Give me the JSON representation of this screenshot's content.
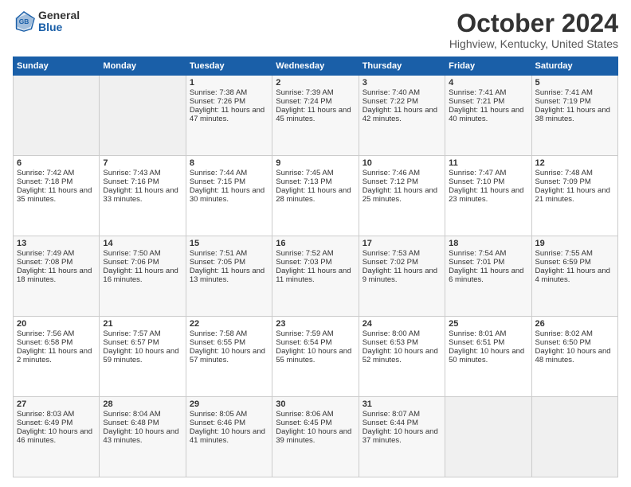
{
  "logo": {
    "general": "General",
    "blue": "Blue"
  },
  "header": {
    "month": "October 2024",
    "location": "Highview, Kentucky, United States"
  },
  "weekdays": [
    "Sunday",
    "Monday",
    "Tuesday",
    "Wednesday",
    "Thursday",
    "Friday",
    "Saturday"
  ],
  "weeks": [
    [
      {
        "day": "",
        "content": ""
      },
      {
        "day": "",
        "content": ""
      },
      {
        "day": "1",
        "content": "Sunrise: 7:38 AM\nSunset: 7:26 PM\nDaylight: 11 hours and 47 minutes."
      },
      {
        "day": "2",
        "content": "Sunrise: 7:39 AM\nSunset: 7:24 PM\nDaylight: 11 hours and 45 minutes."
      },
      {
        "day": "3",
        "content": "Sunrise: 7:40 AM\nSunset: 7:22 PM\nDaylight: 11 hours and 42 minutes."
      },
      {
        "day": "4",
        "content": "Sunrise: 7:41 AM\nSunset: 7:21 PM\nDaylight: 11 hours and 40 minutes."
      },
      {
        "day": "5",
        "content": "Sunrise: 7:41 AM\nSunset: 7:19 PM\nDaylight: 11 hours and 38 minutes."
      }
    ],
    [
      {
        "day": "6",
        "content": "Sunrise: 7:42 AM\nSunset: 7:18 PM\nDaylight: 11 hours and 35 minutes."
      },
      {
        "day": "7",
        "content": "Sunrise: 7:43 AM\nSunset: 7:16 PM\nDaylight: 11 hours and 33 minutes."
      },
      {
        "day": "8",
        "content": "Sunrise: 7:44 AM\nSunset: 7:15 PM\nDaylight: 11 hours and 30 minutes."
      },
      {
        "day": "9",
        "content": "Sunrise: 7:45 AM\nSunset: 7:13 PM\nDaylight: 11 hours and 28 minutes."
      },
      {
        "day": "10",
        "content": "Sunrise: 7:46 AM\nSunset: 7:12 PM\nDaylight: 11 hours and 25 minutes."
      },
      {
        "day": "11",
        "content": "Sunrise: 7:47 AM\nSunset: 7:10 PM\nDaylight: 11 hours and 23 minutes."
      },
      {
        "day": "12",
        "content": "Sunrise: 7:48 AM\nSunset: 7:09 PM\nDaylight: 11 hours and 21 minutes."
      }
    ],
    [
      {
        "day": "13",
        "content": "Sunrise: 7:49 AM\nSunset: 7:08 PM\nDaylight: 11 hours and 18 minutes."
      },
      {
        "day": "14",
        "content": "Sunrise: 7:50 AM\nSunset: 7:06 PM\nDaylight: 11 hours and 16 minutes."
      },
      {
        "day": "15",
        "content": "Sunrise: 7:51 AM\nSunset: 7:05 PM\nDaylight: 11 hours and 13 minutes."
      },
      {
        "day": "16",
        "content": "Sunrise: 7:52 AM\nSunset: 7:03 PM\nDaylight: 11 hours and 11 minutes."
      },
      {
        "day": "17",
        "content": "Sunrise: 7:53 AM\nSunset: 7:02 PM\nDaylight: 11 hours and 9 minutes."
      },
      {
        "day": "18",
        "content": "Sunrise: 7:54 AM\nSunset: 7:01 PM\nDaylight: 11 hours and 6 minutes."
      },
      {
        "day": "19",
        "content": "Sunrise: 7:55 AM\nSunset: 6:59 PM\nDaylight: 11 hours and 4 minutes."
      }
    ],
    [
      {
        "day": "20",
        "content": "Sunrise: 7:56 AM\nSunset: 6:58 PM\nDaylight: 11 hours and 2 minutes."
      },
      {
        "day": "21",
        "content": "Sunrise: 7:57 AM\nSunset: 6:57 PM\nDaylight: 10 hours and 59 minutes."
      },
      {
        "day": "22",
        "content": "Sunrise: 7:58 AM\nSunset: 6:55 PM\nDaylight: 10 hours and 57 minutes."
      },
      {
        "day": "23",
        "content": "Sunrise: 7:59 AM\nSunset: 6:54 PM\nDaylight: 10 hours and 55 minutes."
      },
      {
        "day": "24",
        "content": "Sunrise: 8:00 AM\nSunset: 6:53 PM\nDaylight: 10 hours and 52 minutes."
      },
      {
        "day": "25",
        "content": "Sunrise: 8:01 AM\nSunset: 6:51 PM\nDaylight: 10 hours and 50 minutes."
      },
      {
        "day": "26",
        "content": "Sunrise: 8:02 AM\nSunset: 6:50 PM\nDaylight: 10 hours and 48 minutes."
      }
    ],
    [
      {
        "day": "27",
        "content": "Sunrise: 8:03 AM\nSunset: 6:49 PM\nDaylight: 10 hours and 46 minutes."
      },
      {
        "day": "28",
        "content": "Sunrise: 8:04 AM\nSunset: 6:48 PM\nDaylight: 10 hours and 43 minutes."
      },
      {
        "day": "29",
        "content": "Sunrise: 8:05 AM\nSunset: 6:46 PM\nDaylight: 10 hours and 41 minutes."
      },
      {
        "day": "30",
        "content": "Sunrise: 8:06 AM\nSunset: 6:45 PM\nDaylight: 10 hours and 39 minutes."
      },
      {
        "day": "31",
        "content": "Sunrise: 8:07 AM\nSunset: 6:44 PM\nDaylight: 10 hours and 37 minutes."
      },
      {
        "day": "",
        "content": ""
      },
      {
        "day": "",
        "content": ""
      }
    ]
  ]
}
